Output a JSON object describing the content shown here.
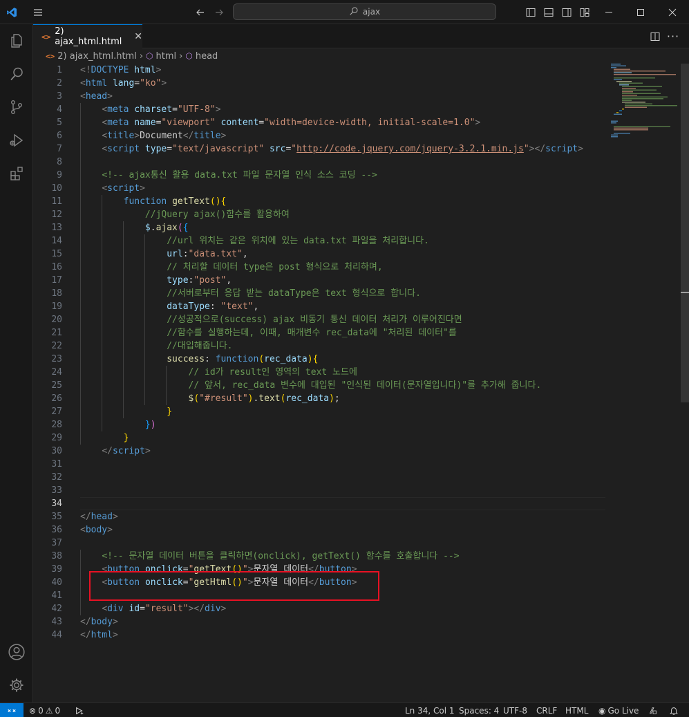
{
  "titlebar": {
    "search_text": "ajax",
    "icons": [
      "vscode-logo-icon",
      "menu-icon",
      "back-arrow-icon",
      "forward-arrow-icon",
      "search-icon",
      "toggle-primary-sidebar-icon",
      "toggle-panel-icon",
      "toggle-secondary-sidebar-icon",
      "customize-layout-icon",
      "minimize-icon",
      "maximize-icon",
      "close-icon"
    ]
  },
  "activity_bar": {
    "items": [
      "explorer-icon",
      "search-icon",
      "source-control-icon",
      "run-debug-icon",
      "extensions-icon"
    ],
    "bottom": [
      "account-icon",
      "manage-gear-icon"
    ]
  },
  "tab": {
    "label": "2) ajax_html.html",
    "icon": "html-file-icon"
  },
  "breadcrumb": {
    "file": "2) ajax_html.html",
    "items": [
      "html",
      "head"
    ]
  },
  "editor": {
    "active_line": 34,
    "lines": [
      {
        "n": "1",
        "html": "<span class=\"pb\">&lt;!</span><span class=\"t\">DOCTYPE</span> <span class=\"a\">html</span><span class=\"pb\">&gt;</span>"
      },
      {
        "n": "2",
        "html": "<span class=\"pb\">&lt;</span><span class=\"t\">html</span> <span class=\"a\">lang</span><span class=\"w\">=</span><span class=\"s\">\"ko\"</span><span class=\"pb\">&gt;</span>"
      },
      {
        "n": "3",
        "html": "<span class=\"pb\">&lt;</span><span class=\"t\">head</span><span class=\"pb\">&gt;</span>"
      },
      {
        "n": "4",
        "html": "    <span class=\"pb\">&lt;</span><span class=\"t\">meta</span> <span class=\"a\">charset</span><span class=\"w\">=</span><span class=\"s\">\"UTF-8\"</span><span class=\"pb\">&gt;</span>"
      },
      {
        "n": "5",
        "html": "    <span class=\"pb\">&lt;</span><span class=\"t\">meta</span> <span class=\"a\">name</span><span class=\"w\">=</span><span class=\"s\">\"viewport\"</span> <span class=\"a\">content</span><span class=\"w\">=</span><span class=\"s\">\"width=device-width, initial-scale=1.0\"</span><span class=\"pb\">&gt;</span>"
      },
      {
        "n": "6",
        "html": "    <span class=\"pb\">&lt;</span><span class=\"t\">title</span><span class=\"pb\">&gt;</span><span class=\"w\">Document</span><span class=\"pb\">&lt;/</span><span class=\"t\">title</span><span class=\"pb\">&gt;</span>"
      },
      {
        "n": "7",
        "html": "    <span class=\"pb\">&lt;</span><span class=\"t\">script</span> <span class=\"a\">type</span><span class=\"w\">=</span><span class=\"s\">\"text/javascript\"</span> <span class=\"a\">src</span><span class=\"w\">=</span><span class=\"s\">\"<span class=\"u\">http://code.jquery.com/jquery-3.2.1.min.js</span>\"</span><span class=\"pb\">&gt;&lt;/</span><span class=\"t\">script</span><span class=\"pb\">&gt;</span>"
      },
      {
        "n": "8",
        "html": ""
      },
      {
        "n": "9",
        "html": "    <span class=\"c\">&lt;!-- ajax통신 활용 data.txt 파일 문자열 인식 소스 코딩 --&gt;</span>"
      },
      {
        "n": "10",
        "html": "    <span class=\"pb\">&lt;</span><span class=\"t\">script</span><span class=\"pb\">&gt;</span>"
      },
      {
        "n": "11",
        "html": "        <span class=\"k\">function</span> <span class=\"f\">getText</span><span class=\"y\">()</span><span class=\"y\">{</span>"
      },
      {
        "n": "12",
        "html": "            <span class=\"c\">//jQuery ajax()함수를 활용하여</span>"
      },
      {
        "n": "13",
        "html": "            <span class=\"a\">$</span><span class=\"w\">.</span><span class=\"f\">ajax</span><span class=\"m\">(</span><span class=\"b\">{</span>"
      },
      {
        "n": "14",
        "html": "                <span class=\"c\">//url 위치는 같은 위치에 있는 data.txt 파일을 처리합니다.</span>"
      },
      {
        "n": "15",
        "html": "                <span class=\"a\">url</span><span class=\"w\">:</span><span class=\"s\">\"data.txt\"</span><span class=\"w\">,</span>"
      },
      {
        "n": "16",
        "html": "                <span class=\"c\">// 처리할 데이터 type은 post 형식으로 처리하며,</span>"
      },
      {
        "n": "17",
        "html": "                <span class=\"a\">type</span><span class=\"w\">:</span><span class=\"s\">\"post\"</span><span class=\"w\">,</span>"
      },
      {
        "n": "18",
        "html": "                <span class=\"c\">//서버로부터 응답 받는 dataType은 text 형식으로 합니다.</span>"
      },
      {
        "n": "19",
        "html": "                <span class=\"a\">dataType</span><span class=\"w\">: </span><span class=\"s\">\"text\"</span><span class=\"w\">,</span>"
      },
      {
        "n": "20",
        "html": "                <span class=\"c\">//성공적으로(success) ajax 비동기 통신 데이터 처리가 이루어진다면</span>"
      },
      {
        "n": "21",
        "html": "                <span class=\"c\">//함수를 실행하는데, 이때, 매개변수 rec_data에 \"처리된 데이터\"를</span>"
      },
      {
        "n": "22",
        "html": "                <span class=\"c\">//대입해줍니다.</span>"
      },
      {
        "n": "23",
        "html": "                <span class=\"f\">success</span><span class=\"w\">: </span><span class=\"k\">function</span><span class=\"y\">(</span><span class=\"a\">rec_data</span><span class=\"y\">)</span><span class=\"y\">{</span>"
      },
      {
        "n": "24",
        "html": "                    <span class=\"c\">// id가 result인 영역의 text 노드에</span>"
      },
      {
        "n": "25",
        "html": "                    <span class=\"c\">// 앞서, rec_data 변수에 대입된 \"인식된 데이터(문자열입니다)\"를 추가해 줍니다.</span>"
      },
      {
        "n": "26",
        "html": "                    <span class=\"f\">$</span><span class=\"y\">(</span><span class=\"s\">\"#result\"</span><span class=\"y\">)</span><span class=\"w\">.</span><span class=\"f\">text</span><span class=\"y\">(</span><span class=\"a\">rec_data</span><span class=\"y\">)</span><span class=\"w\">;</span>"
      },
      {
        "n": "27",
        "html": "                <span class=\"y\">}</span>"
      },
      {
        "n": "28",
        "html": "            <span class=\"b\">}</span><span class=\"m\">)</span>"
      },
      {
        "n": "29",
        "html": "        <span class=\"y\">}</span>"
      },
      {
        "n": "30",
        "html": "    <span class=\"pb\">&lt;/</span><span class=\"t\">script</span><span class=\"pb\">&gt;</span>"
      },
      {
        "n": "31",
        "html": ""
      },
      {
        "n": "32",
        "html": ""
      },
      {
        "n": "33",
        "html": ""
      },
      {
        "n": "34",
        "html": ""
      },
      {
        "n": "35",
        "html": "<span class=\"pb\">&lt;/</span><span class=\"t\">head</span><span class=\"pb\">&gt;</span>"
      },
      {
        "n": "36",
        "html": "<span class=\"pb\">&lt;</span><span class=\"t\">body</span><span class=\"pb\">&gt;</span>"
      },
      {
        "n": "37",
        "html": ""
      },
      {
        "n": "38",
        "html": "    <span class=\"c\">&lt;!-- 문자열 데이터 버튼을 클릭하면(onclick), getText() 함수를 호출합니다 --&gt;</span>"
      },
      {
        "n": "39",
        "html": "    <span class=\"pb\">&lt;</span><span class=\"t\">button</span> <span class=\"a\">onclick</span><span class=\"w\">=</span><span class=\"s\">\"</span><span class=\"f\">getText</span><span class=\"y\">()</span><span class=\"s\">\"</span><span class=\"pb\">&gt;</span><span class=\"w\">문자열 데이터</span><span class=\"pb\">&lt;/</span><span class=\"t\">button</span><span class=\"pb\">&gt;</span>"
      },
      {
        "n": "40",
        "html": "    <span class=\"pb\">&lt;</span><span class=\"t\">button</span> <span class=\"a\">onclick</span><span class=\"w\">=</span><span class=\"s\">\"</span><span class=\"f\">getHtml</span><span class=\"y\">()</span><span class=\"s\">\"</span><span class=\"pb\">&gt;</span><span class=\"w\">문자열 데이터</span><span class=\"pb\">&lt;/</span><span class=\"t\">button</span><span class=\"pb\">&gt;</span>"
      },
      {
        "n": "41",
        "html": ""
      },
      {
        "n": "42",
        "html": "    <span class=\"pb\">&lt;</span><span class=\"t\">div</span> <span class=\"a\">id</span><span class=\"w\">=</span><span class=\"s\">\"result\"</span><span class=\"pb\">&gt;&lt;/</span><span class=\"t\">div</span><span class=\"pb\">&gt;</span>"
      },
      {
        "n": "43",
        "html": "<span class=\"pb\">&lt;/</span><span class=\"t\">body</span><span class=\"pb\">&gt;</span>"
      },
      {
        "n": "44",
        "html": "<span class=\"pb\">&lt;/</span><span class=\"t\">html</span><span class=\"pb\">&gt;</span>"
      }
    ]
  },
  "statusbar": {
    "errors": "0",
    "warnings": "0",
    "position": "Ln 34, Col 1",
    "spaces": "Spaces: 4",
    "encoding": "UTF-8",
    "eol": "CRLF",
    "language": "HTML",
    "golive": "Go Live"
  },
  "colors": {
    "accent": "#0078d4",
    "highlight_box": "#e81123",
    "background": "#1f1f1f"
  }
}
